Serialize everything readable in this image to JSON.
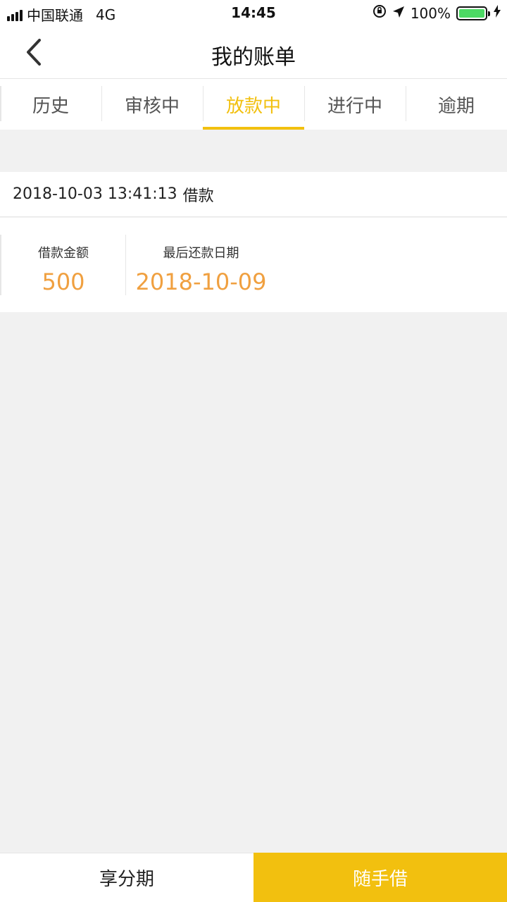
{
  "status_bar": {
    "carrier": "中国联通",
    "network": "4G",
    "time": "14:45",
    "battery": "100%",
    "battery_level": 1.0,
    "battery_color": "#4cd964"
  },
  "nav": {
    "title": "我的账单",
    "back_icon": "chevron-left-icon"
  },
  "tabs": [
    {
      "label": "历史",
      "active": false
    },
    {
      "label": "审核中",
      "active": false
    },
    {
      "label": "放款中",
      "active": true
    },
    {
      "label": "进行中",
      "active": false
    },
    {
      "label": "逾期",
      "active": false
    }
  ],
  "bill": {
    "datetime": "2018-10-03 13:41:13",
    "type": "借款",
    "amount_label": "借款金额",
    "amount": "500",
    "due_label": "最后还款日期",
    "due_date": "2018-10-09"
  },
  "bottom": {
    "installment_label": "享分期",
    "borrow_label": "随手借"
  },
  "colors": {
    "accent": "#f2c00f",
    "value": "#f0a040",
    "background": "#f1f1f1"
  }
}
